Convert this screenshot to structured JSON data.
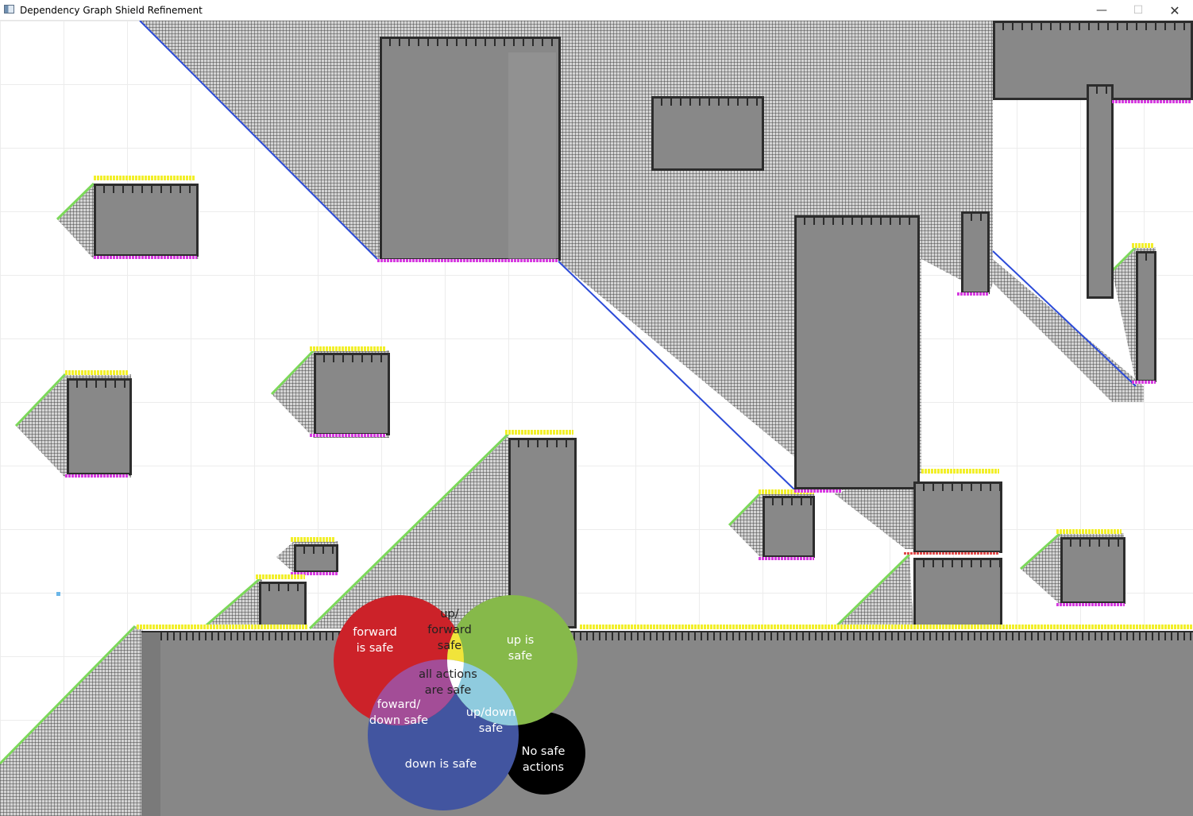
{
  "window": {
    "title": "Dependency Graph Shield Refinement",
    "controls": {
      "minimize": "—",
      "maximize": "☐",
      "close": "✕"
    }
  },
  "legend": {
    "colors": {
      "forward": "#cc2229",
      "up": "#86b94a",
      "down": "#4255a0",
      "up_forward": "#f1e43a",
      "forward_down": "#a34d97",
      "up_down": "#8fcbde",
      "all": "#ffffff",
      "none": "#000000"
    },
    "labels": {
      "forward": "forward\nis safe",
      "up_forward": "up/\nforward\nsafe",
      "up": "up is\nsafe",
      "all": "all actions\nare safe",
      "forward_down": "foward/\ndown safe",
      "up_down": "up/down\nsafe",
      "down": "down is safe",
      "none": "No safe\nactions"
    }
  }
}
